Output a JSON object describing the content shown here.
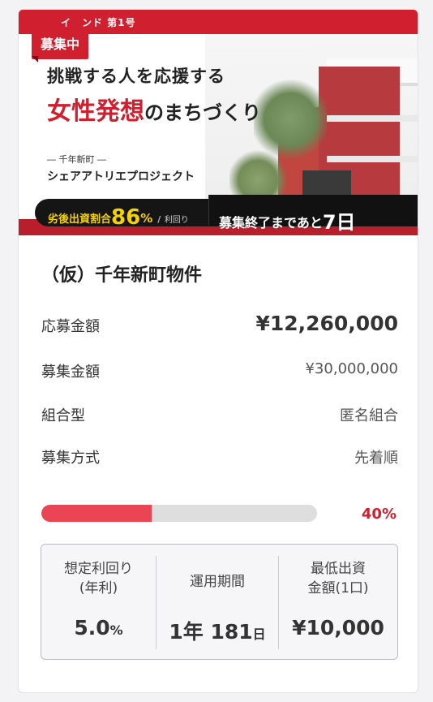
{
  "hero": {
    "fund_label": "イ　ンド 第1号",
    "headline1": "挑戦する人を応援する",
    "headline2_red": "女性発想",
    "headline2_rest": "のまちづくり",
    "sub1": "― 千年新町 ―",
    "sub2": "シェアアトリエプロジェクト",
    "band_left_prefix": "劣後出資割合",
    "band_left_number": "86",
    "band_left_pct": "%",
    "band_left_slash": "/",
    "band_left_faint": "利回り",
    "band_right_text": "募集終了まであと",
    "band_right_day": "7日"
  },
  "badge": "募集中",
  "property": {
    "title": "（仮）千年新町物件",
    "rows": [
      {
        "label": "応募金額",
        "value": "¥12,260,000"
      },
      {
        "label": "募集金額",
        "value": "¥30,000,000"
      },
      {
        "label": "組合型",
        "value": "匿名組合"
      },
      {
        "label": "募集方式",
        "value": "先着順"
      }
    ]
  },
  "progress": {
    "fraction": 0.4,
    "label": "40%"
  },
  "stats": [
    {
      "caption_line1": "想定利回り",
      "caption_line2": "(年利)",
      "value": "5.0",
      "unit": "%"
    },
    {
      "caption_line1": "運用期間",
      "caption_line2": "",
      "value": "1年 181",
      "unit": "日"
    },
    {
      "caption_line1": "最低出資",
      "caption_line2": "金額(1口)",
      "value": "¥10,000",
      "unit": ""
    }
  ],
  "colors": {
    "accent_red": "#d01f2e",
    "progress_fill": "#ea4455",
    "band_yellow": "#f5d200"
  }
}
